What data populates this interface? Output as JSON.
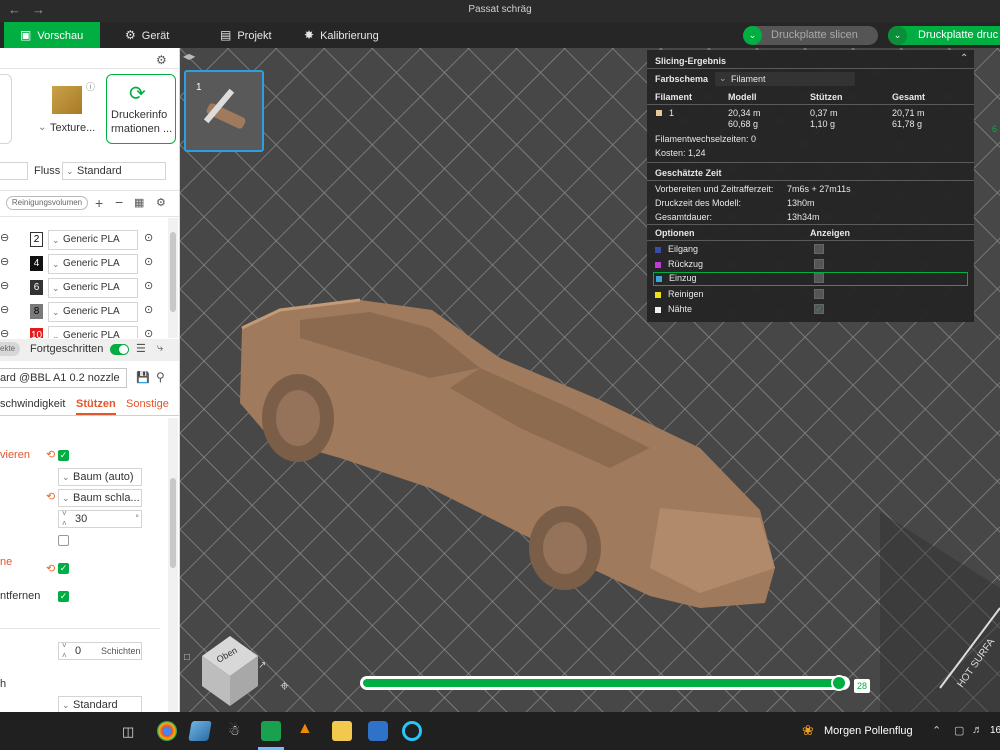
{
  "window": {
    "title": "Passat schräg"
  },
  "tabs": [
    {
      "label": "Vorschau",
      "icon": "preview-icon"
    },
    {
      "label": "Gerät",
      "icon": "device-icon"
    },
    {
      "label": "Projekt",
      "icon": "project-icon"
    },
    {
      "label": "Kalibrierung",
      "icon": "calibration-icon"
    }
  ],
  "actions": {
    "slice_plate": "Druckplatte slicen",
    "print_plate": "Druckplatte druc"
  },
  "left": {
    "texture_label": "Texture...",
    "printer_info": "Druckerinformationen ...",
    "printer_info_line1": "Druckerinfo",
    "printer_info_line2": "rmationen ...",
    "flow_label": "Fluss",
    "flow_value": "Standard",
    "cleaning_volume": "Reinigungsvolumen",
    "filaments": [
      {
        "num": "2",
        "name": "Generic PLA",
        "color": "#ffffff",
        "text": "#000000"
      },
      {
        "num": "4",
        "name": "Generic PLA",
        "color": "#111111",
        "text": "#ffffff"
      },
      {
        "num": "6",
        "name": "Generic PLA",
        "color": "#333333",
        "text": "#ffffff"
      },
      {
        "num": "8",
        "name": "Generic PLA",
        "color": "#7a7a7a",
        "text": "#000000"
      },
      {
        "num": "10",
        "name": "Generic PLA",
        "color": "#e31b1b",
        "text": "#ffffff"
      }
    ],
    "objects_tab": "ekte",
    "advanced_label": "Fortgeschritten",
    "preset": "ard @BBL A1 0.2 nozzle",
    "subtabs": [
      "schwindigkeit",
      "Stützen",
      "Sonstige"
    ],
    "settings": {
      "enable_label": "vieren",
      "type_value": "Baum (auto)",
      "style_value": "Baum schla...",
      "angle_value": "30",
      "label_ne": "ne",
      "remove_label": "ntfernen",
      "layers_value": "0",
      "layers_unit": "Schichten",
      "label_h": "h",
      "standard_value": "Standard"
    }
  },
  "results": {
    "title": "Slicing-Ergebnis",
    "color_scheme_label": "Farbschema",
    "color_scheme_value": "Filament",
    "columns": [
      "Filament",
      "Modell",
      "Stützen",
      "Gesamt"
    ],
    "row": {
      "filament": "1",
      "model_m": "20,34 m",
      "model_g": "60,68 g",
      "support_m": "0,37 m",
      "support_g": "1,10 g",
      "total_m": "20,71 m",
      "total_g": "61,78 g"
    },
    "filament_changes": "Filamentwechselzeiten:  0",
    "cost": "Kosten:  1,24",
    "time_title": "Geschätzte Zeit",
    "prep_label": "Vorbereiten und Zeitrafferzeit:",
    "prep_value": "7m6s + 27m11s",
    "model_time_label": "Druckzeit des Modell:",
    "model_time_value": "13h0m",
    "total_time_label": "Gesamtdauer:",
    "total_time_value": "13h34m",
    "options_label": "Optionen",
    "show_label": "Anzeigen",
    "options": [
      {
        "label": "Eilgang",
        "color": "#3b4bb0",
        "checked": false
      },
      {
        "label": "Rückzug",
        "color": "#c23ad8",
        "checked": false
      },
      {
        "label": "Einzug",
        "color": "#3aa6d8",
        "checked": false
      },
      {
        "label": "Reinigen",
        "color": "#f0e020",
        "checked": false
      },
      {
        "label": "Nähte",
        "color": "#f0f0f0",
        "checked": true
      }
    ]
  },
  "viewport": {
    "layer_value": "28",
    "cube_label": "Oben",
    "plate_text": "HOT SURFA"
  },
  "taskbar": {
    "weather": "Morgen Pollenflug",
    "clock_partial": "16"
  },
  "colors": {
    "accent": "#00ae42",
    "model": "#a07a5c"
  }
}
